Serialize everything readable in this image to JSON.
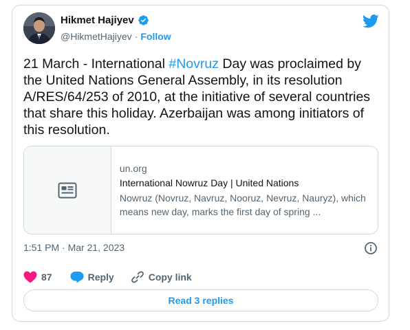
{
  "author": {
    "name": "Hikmet Hajiyev",
    "handle": "@HikmetHajiyev",
    "separator": "·",
    "follow_label": "Follow"
  },
  "tweet": {
    "text_before": "21 March - International ",
    "hashtag": "#Novruz",
    "text_after": " Day was proclaimed by the United Nations General Assembly, in its resolution A/RES/64/253 of 2010, at the initiative of several countries that share this holiday. Azerbaijan was among initiators of this resolution."
  },
  "link_card": {
    "domain": "un.org",
    "title": "International Nowruz Day | United Nations",
    "description": "Nowruz (Novruz, Navruz, Nooruz, Nevruz, Nauryz), which means new day, marks the first day of spring ..."
  },
  "timestamp": "1:51 PM · Mar 21, 2023",
  "actions": {
    "like_count": "87",
    "reply_label": "Reply",
    "copy_link_label": "Copy link"
  },
  "read_replies_label": "Read 3 replies",
  "colors": {
    "accent": "#1d9bf0",
    "like": "#f91880",
    "text": "#0f1419",
    "muted": "#536471",
    "border": "#cfd9de"
  },
  "icons": [
    "verified-badge-icon",
    "twitter-bird-icon",
    "article-icon",
    "info-icon",
    "heart-icon",
    "reply-bubble-icon",
    "link-icon"
  ]
}
